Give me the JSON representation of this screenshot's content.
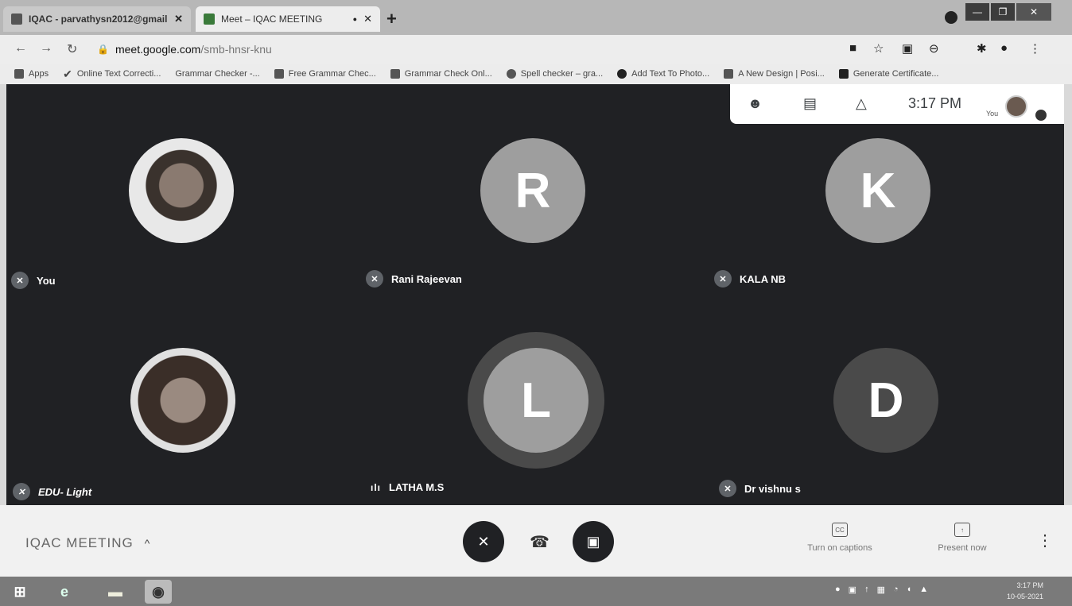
{
  "browser": {
    "tabs": [
      {
        "label": "IQAC - parvathysn2012@gmail",
        "close": "✕"
      },
      {
        "label": "Meet – IQAC MEETING",
        "close": "✕"
      }
    ],
    "new_tab": "+",
    "url_host": "meet.google.com",
    "url_path": "/smb-hnsr-knu",
    "bookmarks": [
      "Apps",
      "Online Text Correcti...",
      "Grammar Checker -...",
      "Free Grammar Chec...",
      "Grammar Check Onl...",
      "Spell checker – gra...",
      "Add Text To Photo...",
      "A New Design | Posi...",
      "Generate Certificate..."
    ]
  },
  "meet": {
    "top_panel": {
      "people_icon": "people-icon",
      "chat_icon": "chat-icon",
      "activities_icon": "activities-icon",
      "time": "3:17 PM",
      "you_label": "You"
    },
    "participants": [
      {
        "name": "You",
        "initial": ""
      },
      {
        "name": "Rani Rajeevan",
        "initial": "R"
      },
      {
        "name": "KALA NB",
        "initial": "K"
      },
      {
        "name": "EDU- Light",
        "initial": ""
      },
      {
        "name": "LATHA M.S",
        "initial": "L"
      },
      {
        "name": "Dr vishnu s",
        "initial": "D"
      }
    ],
    "meeting_title": "IQAC MEETING",
    "captions_label": "Turn on captions",
    "present_label": "Present now"
  },
  "system": {
    "date": "10-05-2021",
    "time": "3:17 PM"
  },
  "colors": {
    "meet_bg": "#202124",
    "tile_initial": "#9e9e9e",
    "control_btn": "#202124"
  }
}
